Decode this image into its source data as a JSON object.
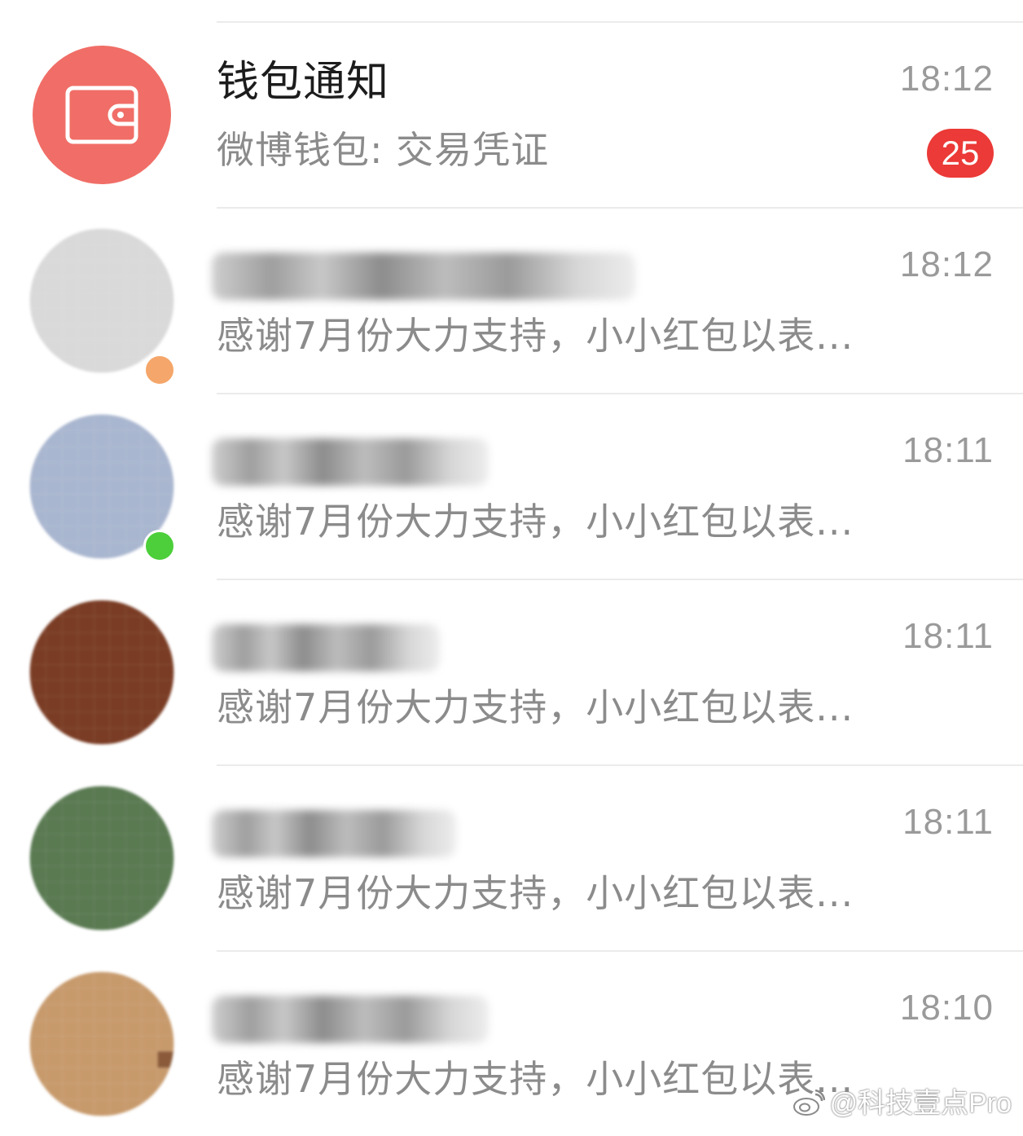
{
  "colors": {
    "wallet_avatar": "#f06e67",
    "badge": "#eb3a37",
    "time": "#9a9a9a",
    "preview": "#8b8b8b",
    "title": "#1c1c1c",
    "divider": "#ebebeb",
    "presence_orange": "#f5a66a",
    "presence_green": "#4ccf3a"
  },
  "conversations": [
    {
      "name": "钱包通知",
      "preview": "微博钱包: 交易凭证",
      "time": "18:12",
      "unread": "25",
      "avatar_icon": "wallet-icon"
    },
    {
      "name": "",
      "preview": "感谢7月份大力支持，小小红包以表...",
      "time": "18:12",
      "avatar_icon": "user-avatar"
    },
    {
      "name": "",
      "preview": "感谢7月份大力支持，小小红包以表...",
      "time": "18:11",
      "avatar_icon": "user-avatar"
    },
    {
      "name": "",
      "preview": "感谢7月份大力支持，小小红包以表...",
      "time": "18:11",
      "avatar_icon": "user-avatar"
    },
    {
      "name": "",
      "preview": "感谢7月份大力支持，小小红包以表...",
      "time": "18:11",
      "avatar_icon": "user-avatar"
    },
    {
      "name": "",
      "preview": "感谢7月份大力支持，小小红包以表...",
      "time": "18:10",
      "avatar_icon": "user-avatar"
    }
  ],
  "watermark": {
    "text": "@科技壹点Pro",
    "icon": "weibo-logo-icon"
  }
}
